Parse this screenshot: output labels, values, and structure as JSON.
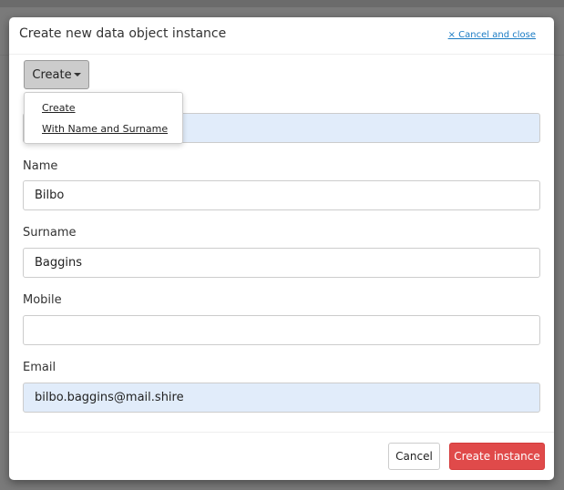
{
  "modal": {
    "title": "Create new data object instance",
    "close_label": "× Cancel and close"
  },
  "create_menu": {
    "button_label": "Create",
    "items": [
      "Create",
      "With Name and Surname"
    ]
  },
  "fields": [
    {
      "label": "",
      "value": ""
    },
    {
      "label": "Name",
      "value": "Bilbo"
    },
    {
      "label": "Surname",
      "value": "Baggins"
    },
    {
      "label": "Mobile",
      "value": ""
    },
    {
      "label": "Email",
      "value": "bilbo.baggins@mail.shire"
    }
  ],
  "footer": {
    "cancel_label": "Cancel",
    "submit_label": "Create instance"
  },
  "colors": {
    "primary": "#e04a4a",
    "link": "#1a7bc4",
    "highlight": "#e1ecfa"
  }
}
